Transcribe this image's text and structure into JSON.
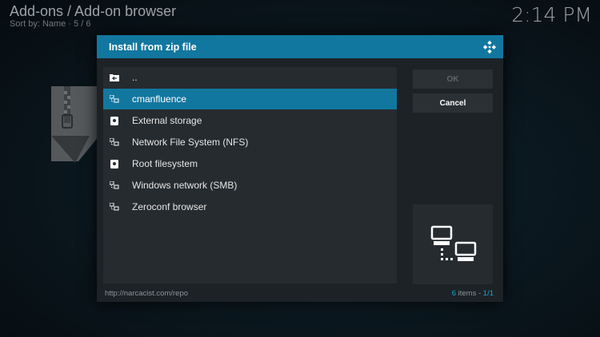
{
  "background": {
    "title": "Add-ons / Add-on browser",
    "sort_label": "Sort by: Name",
    "position": "5 / 6",
    "clock": "2:14 PM"
  },
  "dialog": {
    "title": "Install from zip file",
    "ok_label": "OK",
    "cancel_label": "Cancel",
    "path": "http://narcacist.com/repo",
    "items_count": "6",
    "items_suffix": "items",
    "page": "1/1"
  },
  "file_list": [
    {
      "label": "..",
      "icon": "folder-up-icon",
      "selected": false
    },
    {
      "label": "cmanfluence",
      "icon": "network-icon",
      "selected": true
    },
    {
      "label": "External storage",
      "icon": "drive-icon",
      "selected": false
    },
    {
      "label": "Network File System (NFS)",
      "icon": "network-icon",
      "selected": false
    },
    {
      "label": "Root filesystem",
      "icon": "drive-icon",
      "selected": false
    },
    {
      "label": "Windows network (SMB)",
      "icon": "network-icon",
      "selected": false
    },
    {
      "label": "Zeroconf browser",
      "icon": "network-icon",
      "selected": false
    }
  ],
  "colors": {
    "accent": "#12779f",
    "highlight_text": "#12a6dd",
    "dialog_bg": "#1d2226",
    "list_bg": "#262b2f"
  }
}
